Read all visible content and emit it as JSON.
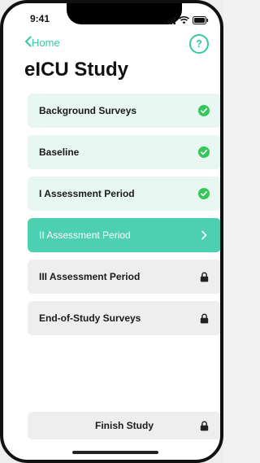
{
  "status_bar": {
    "time": "9:41",
    "icons": [
      "signal-icon",
      "wifi-icon",
      "battery-icon"
    ]
  },
  "nav": {
    "back_label": "Home",
    "help_label": "?"
  },
  "title": "eICU Study",
  "steps": [
    {
      "label": "Background Surveys",
      "status": "completed",
      "status_icon": "checkmark-icon"
    },
    {
      "label": "Baseline",
      "status": "completed",
      "status_icon": "checkmark-icon"
    },
    {
      "label": "I Assessment Period",
      "status": "completed",
      "status_icon": "checkmark-icon"
    },
    {
      "label": "II Assessment Period",
      "status": "current",
      "status_icon": "chevron-right-icon"
    },
    {
      "label": "III Assessment Period",
      "status": "locked",
      "status_icon": "lock-icon"
    },
    {
      "label": "End-of-Study Surveys",
      "status": "locked",
      "status_icon": "lock-icon"
    }
  ],
  "finish": {
    "label": "Finish Study",
    "status": "locked",
    "status_icon": "lock-icon"
  },
  "colors": {
    "accent": "#35c9a8",
    "current_bg": "#4dcfb1",
    "completed_bg": "#e9f7f3",
    "locked_bg": "#eeeeee",
    "check_green": "#34c759"
  }
}
